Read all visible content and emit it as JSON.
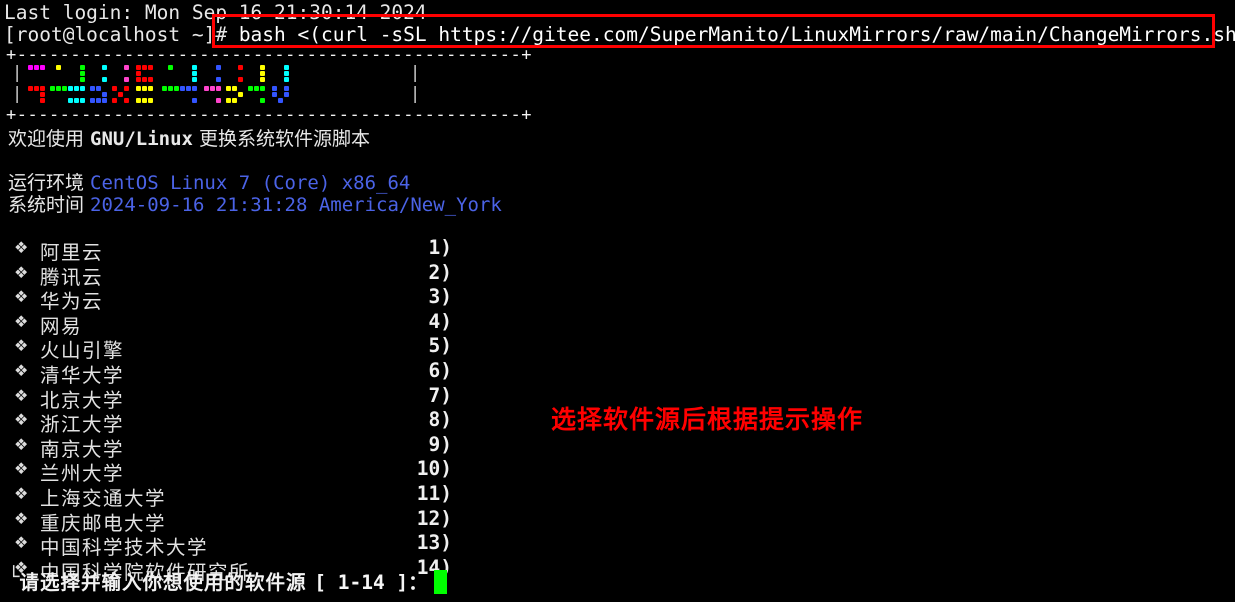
{
  "terminal": {
    "background_color": "#000000",
    "foreground_color": "#e8e8e8",
    "accent_blue": "#4b63e6",
    "accent_red": "#ff0000",
    "cursor_color": "#00ff00",
    "last_login": "Last login: Mon Sep 16 21:30:14 2024",
    "prompt_user": "[root@localhost ~]# ",
    "command": "bash <(curl -sSL https://gitee.com/SuperManito/LinuxMirrors/raw/main/ChangeMirrors.sh)"
  },
  "banner": {
    "top_border": "+-----------------------------------------------+",
    "bottom_border": "+-----------------------------------------------+",
    "pipe": "|",
    "art_text": "LinuxMirrors",
    "colors": [
      "#ff00ff",
      "#ff4500",
      "#ffff00",
      "#00ff00",
      "#00ffff",
      "#ff0000",
      "#3355ff",
      "#ff44cc"
    ]
  },
  "welcome": {
    "prefix": "欢迎使用 ",
    "mono": "GNU/Linux",
    "suffix": " 更换系统软件源脚本"
  },
  "info": {
    "env_label": "运行环境 ",
    "env_value": "CentOS Linux 7 (Core) x86_64",
    "time_label": "系统时间 ",
    "time_value": "2024-09-16 21:31:28 America/New_York"
  },
  "mirror_list": {
    "bullet_icon": "❖",
    "items": [
      {
        "name": "阿里云",
        "index": "1)"
      },
      {
        "name": "腾讯云",
        "index": "2)"
      },
      {
        "name": "华为云",
        "index": "3)"
      },
      {
        "name": "网易",
        "index": "4)"
      },
      {
        "name": "火山引擎",
        "index": "5)"
      },
      {
        "name": "清华大学",
        "index": "6)"
      },
      {
        "name": "北京大学",
        "index": "7)"
      },
      {
        "name": "浙江大学",
        "index": "8)"
      },
      {
        "name": "南京大学",
        "index": "9)"
      },
      {
        "name": "兰州大学",
        "index": "10)"
      },
      {
        "name": "上海交通大学",
        "index": "11)"
      },
      {
        "name": "重庆邮电大学",
        "index": "12)"
      },
      {
        "name": "中国科学技术大学",
        "index": "13)"
      },
      {
        "name": "中国科学院软件研究所",
        "index": "14)"
      }
    ]
  },
  "annotation": {
    "text": "选择软件源后根据提示操作",
    "color": "#ff0000"
  },
  "input_prompt": {
    "corner": "└",
    "question": "请选择并输入你想使用的软件源 ",
    "range": "[ 1-14 ]：",
    "cursor": ""
  }
}
